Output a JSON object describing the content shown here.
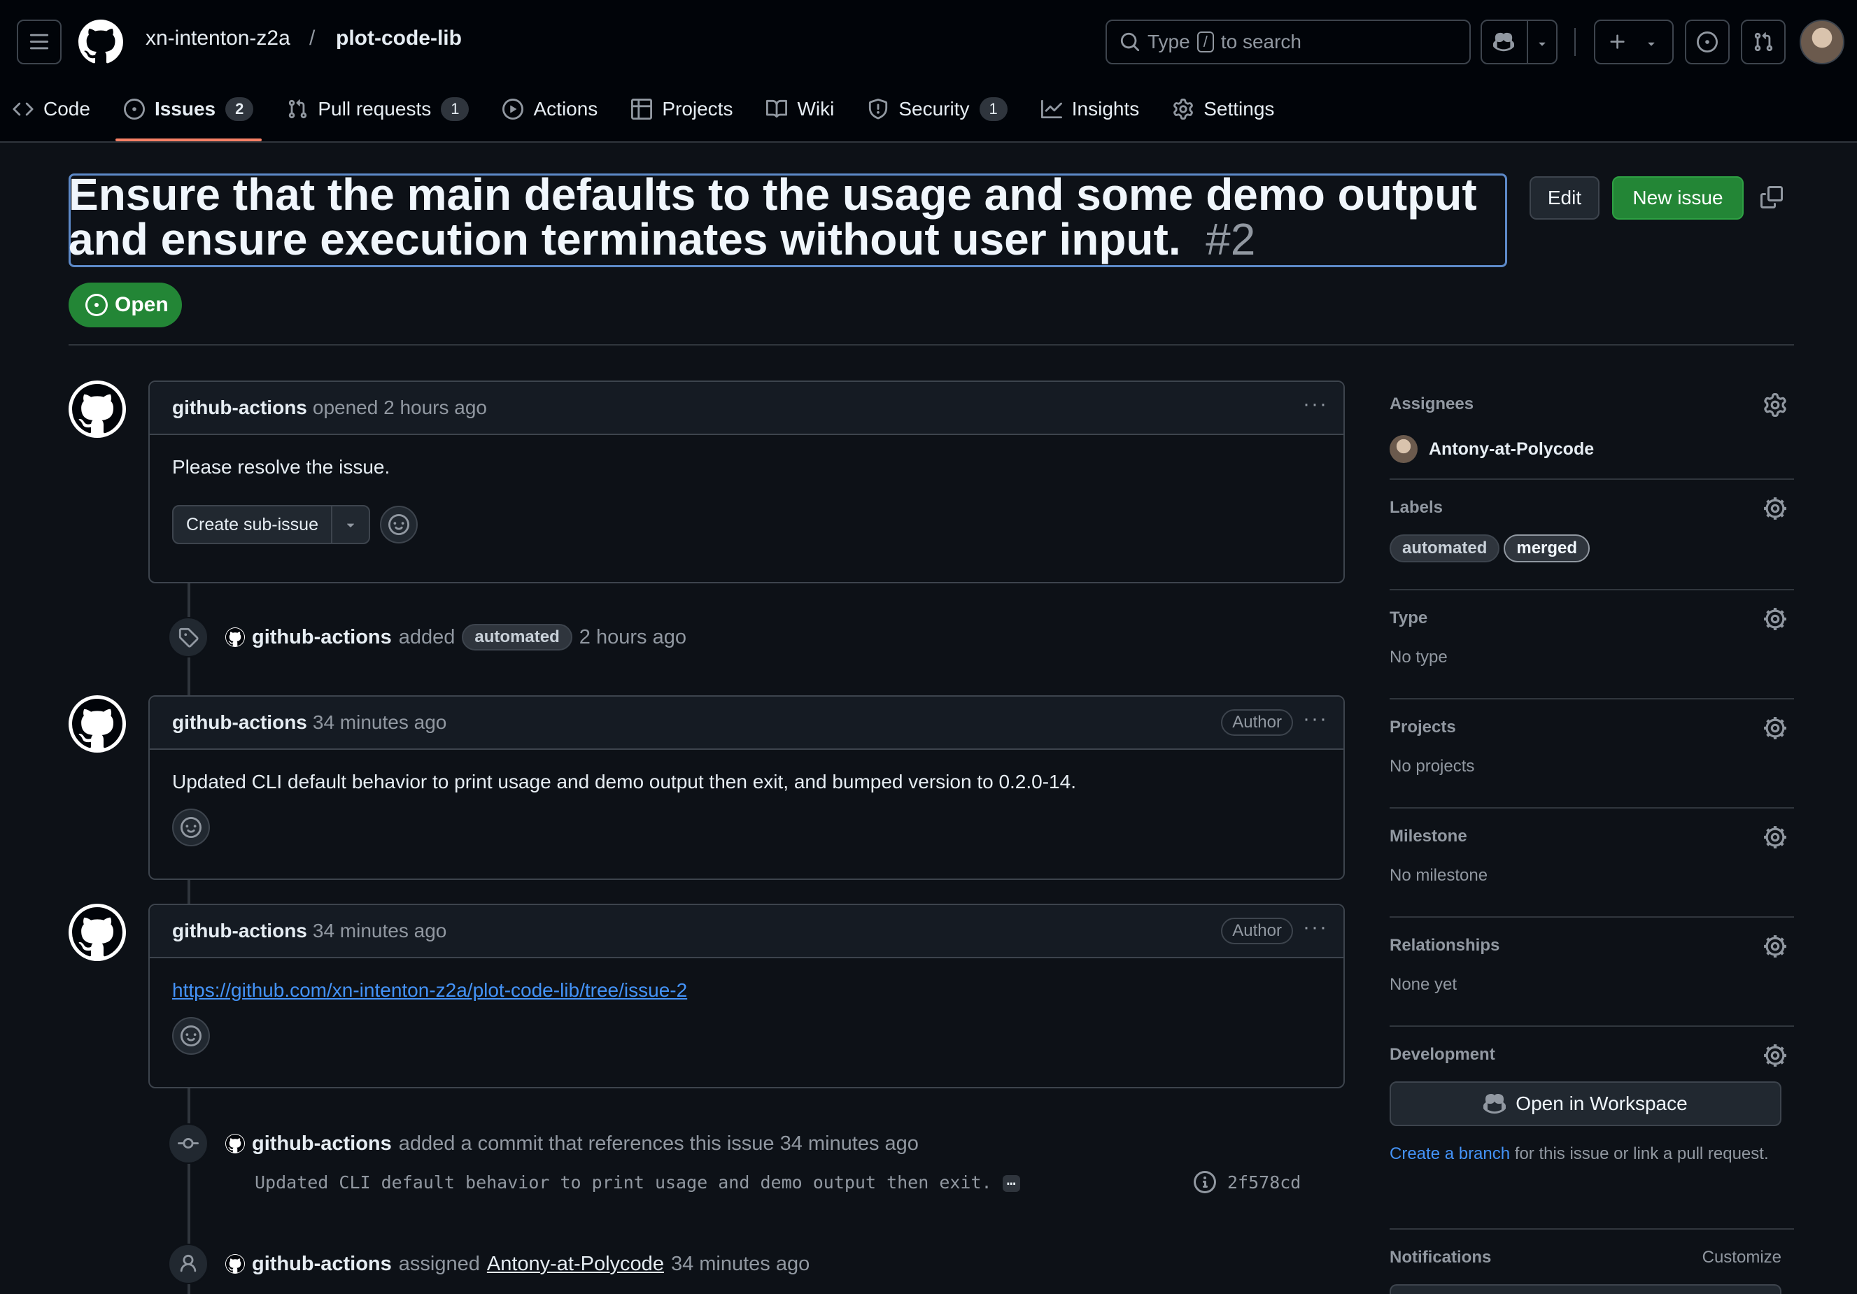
{
  "header": {
    "owner": "xn-intenton-z2a",
    "separator": "/",
    "repo": "plot-code-lib",
    "search_prefix": "Type",
    "search_key": "/",
    "search_suffix": "to search"
  },
  "tabs": [
    {
      "label": "Code"
    },
    {
      "label": "Issues",
      "count": "2"
    },
    {
      "label": "Pull requests",
      "count": "1"
    },
    {
      "label": "Actions"
    },
    {
      "label": "Projects"
    },
    {
      "label": "Wiki"
    },
    {
      "label": "Security",
      "count": "1"
    },
    {
      "label": "Insights"
    },
    {
      "label": "Settings"
    }
  ],
  "issue": {
    "title": "Ensure that the main defaults to the usage and some demo output and ensure execution terminates without user input.",
    "number": "#2",
    "state": "Open",
    "edit_label": "Edit",
    "new_issue_label": "New issue"
  },
  "timeline": {
    "comment1": {
      "author": "github-actions",
      "meta": "opened 2 hours ago",
      "body": "Please resolve the issue.",
      "sub_issue_label": "Create sub-issue"
    },
    "event_label": {
      "author": "github-actions",
      "action": "added",
      "label": "automated",
      "time": "2 hours ago"
    },
    "comment2": {
      "author": "github-actions",
      "meta": "34 minutes ago",
      "badge": "Author",
      "body": "Updated CLI default behavior to print usage and demo output then exit, and bumped version to 0.2.0-14."
    },
    "comment3": {
      "author": "github-actions",
      "meta": "34 minutes ago",
      "badge": "Author",
      "link": "https://github.com/xn-intenton-z2a/plot-code-lib/tree/issue-2"
    },
    "event_commit": {
      "author": "github-actions",
      "action": "added a commit that references this issue 34 minutes ago",
      "message": "Updated CLI default behavior to print usage and demo output then exit.",
      "ellipsis": "…",
      "sha": "2f578cd"
    },
    "event_assign": {
      "author": "github-actions",
      "action": "assigned",
      "assignee": "Antony-at-Polycode",
      "time": "34 minutes ago"
    }
  },
  "sidebar": {
    "assignees": {
      "title": "Assignees",
      "name": "Antony-at-Polycode"
    },
    "labels": {
      "title": "Labels",
      "items": [
        "automated",
        "merged"
      ]
    },
    "type": {
      "title": "Type",
      "value": "No type"
    },
    "projects": {
      "title": "Projects",
      "value": "No projects"
    },
    "milestone": {
      "title": "Milestone",
      "value": "No milestone"
    },
    "relationships": {
      "title": "Relationships",
      "value": "None yet"
    },
    "development": {
      "title": "Development",
      "workspace_button": "Open in Workspace",
      "create_branch_link": "Create a branch",
      "create_branch_rest": "for this issue or link a pull request."
    },
    "notifications": {
      "title": "Notifications",
      "customize": "Customize"
    }
  },
  "colors": {
    "accent_green": "#238636",
    "tab_underline": "#f78166",
    "link_blue": "#4493f8"
  }
}
